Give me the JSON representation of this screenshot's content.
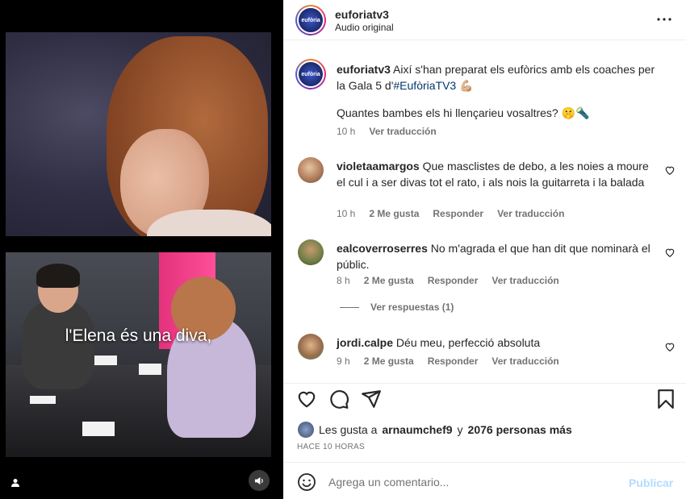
{
  "media": {
    "subtitle": "l'Elena és una diva,",
    "user_icon": "user-icon",
    "sound_icon": "speaker-icon"
  },
  "header": {
    "username": "euforiatv3",
    "audio": "Audio original",
    "avatar_text": "eufòria",
    "more_icon": "more-icon"
  },
  "caption": {
    "username": "euforiatv3",
    "text": "Així s'han preparat els eufòrics amb els coaches per la Gala 5 d'",
    "hashtag": "#EufòriaTV3",
    "emoji": "💪🏼",
    "question": "Quantes bambes els hi llençarieu vosaltres? 🤫🔦",
    "time": "10 h",
    "translate": "Ver traducción"
  },
  "comments": [
    {
      "username": "violetaamargos",
      "text": "Que masclistes de debo, a les noies a moure el cul i a ser divas tot el rato, i als nois la guitarreta i la balada",
      "time": "10 h",
      "likes": "2 Me gusta",
      "reply": "Responder",
      "translate": "Ver traducción"
    },
    {
      "username": "ealcoverroserres",
      "text": "No m'agrada el que han dit que nominarà el públic.",
      "time": "8 h",
      "likes": "2 Me gusta",
      "reply": "Responder",
      "translate": "Ver traducción"
    },
    {
      "username": "jordi.calpe",
      "text": "Déu meu, perfecció absoluta",
      "time": "9 h",
      "likes": "2 Me gusta",
      "reply": "Responder",
      "translate": "Ver traducción"
    }
  ],
  "replies": {
    "label": "Ver respuestas (1)"
  },
  "actions": {
    "icons": [
      "heart-icon",
      "comment-icon",
      "share-icon",
      "bookmark-icon"
    ],
    "likes_prefix": "Les gusta a",
    "likes_user": "arnaumchef9",
    "likes_and": "y",
    "likes_count": "2076 personas más",
    "time": "HACE 10 HORAS"
  },
  "add_comment": {
    "placeholder": "Agrega un comentario...",
    "post": "Publicar",
    "emoji_icon": "emoji-icon"
  },
  "colors": {
    "link": "#00376b",
    "muted": "#737373",
    "post_disabled": "#b3dbff"
  }
}
